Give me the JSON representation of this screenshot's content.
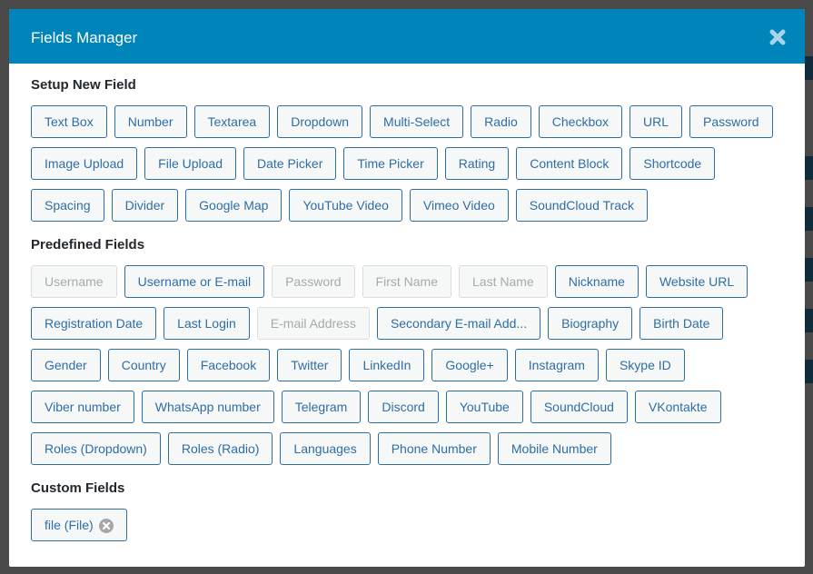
{
  "modal": {
    "title": "Fields Manager",
    "close_icon": "close-icon"
  },
  "sections": {
    "setup": {
      "title": "Setup New Field",
      "fields": [
        {
          "label": "Text Box",
          "disabled": false
        },
        {
          "label": "Number",
          "disabled": false
        },
        {
          "label": "Textarea",
          "disabled": false
        },
        {
          "label": "Dropdown",
          "disabled": false
        },
        {
          "label": "Multi-Select",
          "disabled": false
        },
        {
          "label": "Radio",
          "disabled": false
        },
        {
          "label": "Checkbox",
          "disabled": false
        },
        {
          "label": "URL",
          "disabled": false
        },
        {
          "label": "Password",
          "disabled": false
        },
        {
          "label": "Image Upload",
          "disabled": false
        },
        {
          "label": "File Upload",
          "disabled": false
        },
        {
          "label": "Date Picker",
          "disabled": false
        },
        {
          "label": "Time Picker",
          "disabled": false
        },
        {
          "label": "Rating",
          "disabled": false
        },
        {
          "label": "Content Block",
          "disabled": false
        },
        {
          "label": "Shortcode",
          "disabled": false
        },
        {
          "label": "Spacing",
          "disabled": false
        },
        {
          "label": "Divider",
          "disabled": false
        },
        {
          "label": "Google Map",
          "disabled": false
        },
        {
          "label": "YouTube Video",
          "disabled": false
        },
        {
          "label": "Vimeo Video",
          "disabled": false
        },
        {
          "label": "SoundCloud Track",
          "disabled": false
        }
      ]
    },
    "predefined": {
      "title": "Predefined Fields",
      "fields": [
        {
          "label": "Username",
          "disabled": true
        },
        {
          "label": "Username or E-mail",
          "disabled": false
        },
        {
          "label": "Password",
          "disabled": true
        },
        {
          "label": "First Name",
          "disabled": true
        },
        {
          "label": "Last Name",
          "disabled": true
        },
        {
          "label": "Nickname",
          "disabled": false
        },
        {
          "label": "Website URL",
          "disabled": false
        },
        {
          "label": "Registration Date",
          "disabled": false
        },
        {
          "label": "Last Login",
          "disabled": false
        },
        {
          "label": "E-mail Address",
          "disabled": true
        },
        {
          "label": "Secondary E-mail Add...",
          "disabled": false
        },
        {
          "label": "Biography",
          "disabled": false
        },
        {
          "label": "Birth Date",
          "disabled": false
        },
        {
          "label": "Gender",
          "disabled": false
        },
        {
          "label": "Country",
          "disabled": false
        },
        {
          "label": "Facebook",
          "disabled": false
        },
        {
          "label": "Twitter",
          "disabled": false
        },
        {
          "label": "LinkedIn",
          "disabled": false
        },
        {
          "label": "Google+",
          "disabled": false
        },
        {
          "label": "Instagram",
          "disabled": false
        },
        {
          "label": "Skype ID",
          "disabled": false
        },
        {
          "label": "Viber number",
          "disabled": false
        },
        {
          "label": "WhatsApp number",
          "disabled": false
        },
        {
          "label": "Telegram",
          "disabled": false
        },
        {
          "label": "Discord",
          "disabled": false
        },
        {
          "label": "YouTube",
          "disabled": false
        },
        {
          "label": "SoundCloud",
          "disabled": false
        },
        {
          "label": "VKontakte",
          "disabled": false
        },
        {
          "label": "Roles (Dropdown)",
          "disabled": false
        },
        {
          "label": "Roles (Radio)",
          "disabled": false
        },
        {
          "label": "Languages",
          "disabled": false
        },
        {
          "label": "Phone Number",
          "disabled": false
        },
        {
          "label": "Mobile Number",
          "disabled": false
        }
      ]
    },
    "custom": {
      "title": "Custom Fields",
      "fields": [
        {
          "label": "file (File)",
          "remove_icon": "remove-circle-icon"
        }
      ]
    }
  },
  "colors": {
    "header_bg": "#0085ba",
    "button_border": "#2e6da4",
    "button_text": "#2e6ea6",
    "disabled_text": "#a7aaad",
    "overlay": "#4a4a4a"
  }
}
